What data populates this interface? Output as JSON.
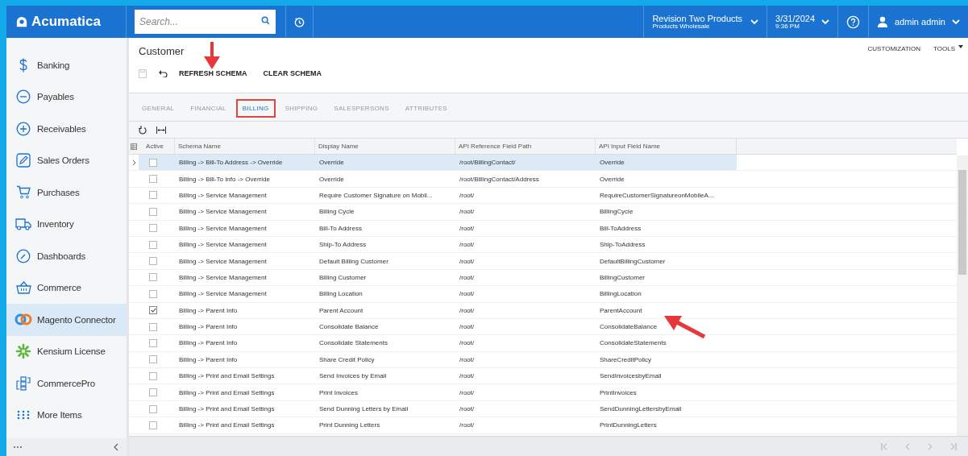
{
  "header": {
    "logo": "Acumatica",
    "search": {
      "placeholder": "Search..."
    },
    "company": {
      "name": "Revision Two Products",
      "branch": "Products Wholesale"
    },
    "datetime": {
      "date": "3/31/2024",
      "time": "9:36 PM"
    },
    "user": "admin admin"
  },
  "sidebar": {
    "items": [
      {
        "label": "Banking",
        "kind": "dollar",
        "selected": false
      },
      {
        "label": "Payables",
        "kind": "minus",
        "selected": false
      },
      {
        "label": "Receivables",
        "kind": "plus",
        "selected": false
      },
      {
        "label": "Sales Orders",
        "kind": "pencil",
        "selected": false
      },
      {
        "label": "Purchases",
        "kind": "cart",
        "selected": false
      },
      {
        "label": "Inventory",
        "kind": "truck",
        "selected": false
      },
      {
        "label": "Dashboards",
        "kind": "gauge",
        "selected": false
      },
      {
        "label": "Commerce",
        "kind": "basket",
        "selected": false
      },
      {
        "label": "Magento Connector",
        "kind": "rings",
        "selected": true
      },
      {
        "label": "Kensium License",
        "kind": "burst",
        "selected": false
      },
      {
        "label": "CommercePro",
        "kind": "blocks",
        "selected": false
      },
      {
        "label": "More Items",
        "kind": "dots",
        "selected": false
      }
    ]
  },
  "page": {
    "title": "Customer",
    "actions": [
      "REFRESH SCHEMA",
      "CLEAR SCHEMA"
    ],
    "links": [
      "CUSTOMIZATION",
      "TOOLS"
    ]
  },
  "tabs": [
    {
      "label": "GENERAL",
      "selected": false,
      "highlighted": false
    },
    {
      "label": "FINANCIAL",
      "selected": false,
      "highlighted": false
    },
    {
      "label": "BILLING",
      "selected": true,
      "highlighted": true
    },
    {
      "label": "SHIPPING",
      "selected": false,
      "highlighted": false
    },
    {
      "label": "SALESPERSONS",
      "selected": false,
      "highlighted": false
    },
    {
      "label": "ATTRIBUTES",
      "selected": false,
      "highlighted": false
    }
  ],
  "table": {
    "columns": [
      "Active",
      "Schema Name",
      "Display Name",
      "API Reference Field Path",
      "API Input Field Name"
    ],
    "rows": [
      {
        "selected": true,
        "active": false,
        "schema": "Billing -> Bill-To Address -> Override",
        "display": "Override",
        "path": "/root/BillingContact/",
        "input": "Override"
      },
      {
        "selected": false,
        "active": false,
        "schema": "Billing -> Bill-To Info -> Override",
        "display": "Override",
        "path": "/root/BillingContact/Address",
        "input": "Override"
      },
      {
        "selected": false,
        "active": false,
        "schema": "Billing -> Service Management",
        "display": "Require Customer Signature on Mobil...",
        "path": "/root/",
        "input": "RequireCustomerSignatureonMobileA..."
      },
      {
        "selected": false,
        "active": false,
        "schema": "Billing -> Service Management",
        "display": "Billing Cycle",
        "path": "/root/",
        "input": "BillingCycle"
      },
      {
        "selected": false,
        "active": false,
        "schema": "Billing -> Service Management",
        "display": "Bill-To Address",
        "path": "/root/",
        "input": "Bill-ToAddress"
      },
      {
        "selected": false,
        "active": false,
        "schema": "Billing -> Service Management",
        "display": "Ship-To Address",
        "path": "/root/",
        "input": "Ship-ToAddress"
      },
      {
        "selected": false,
        "active": false,
        "schema": "Billing -> Service Management",
        "display": "Default Billing Customer",
        "path": "/root/",
        "input": "DefaultBillingCustomer"
      },
      {
        "selected": false,
        "active": false,
        "schema": "Billing -> Service Management",
        "display": "Billing Customer",
        "path": "/root/",
        "input": "BillingCustomer"
      },
      {
        "selected": false,
        "active": false,
        "schema": "Billing -> Service Management",
        "display": "Billing Location",
        "path": "/root/",
        "input": "BillingLocation"
      },
      {
        "selected": false,
        "active": true,
        "schema": "Billing -> Parent Info",
        "display": "Parent Account",
        "path": "/root/",
        "input": "ParentAccount"
      },
      {
        "selected": false,
        "active": false,
        "schema": "Billing -> Parent Info",
        "display": "Consolidate Balance",
        "path": "/root/",
        "input": "ConsolidateBalance"
      },
      {
        "selected": false,
        "active": false,
        "schema": "Billing -> Parent Info",
        "display": "Consolidate Statements",
        "path": "/root/",
        "input": "ConsolidateStatements"
      },
      {
        "selected": false,
        "active": false,
        "schema": "Billing -> Parent Info",
        "display": "Share Credit Policy",
        "path": "/root/",
        "input": "ShareCreditPolicy"
      },
      {
        "selected": false,
        "active": false,
        "schema": "Billing -> Print and Email Settings",
        "display": "Send Invoices by Email",
        "path": "/root/",
        "input": "SendInvoicesbyEmail"
      },
      {
        "selected": false,
        "active": false,
        "schema": "Billing -> Print and Email Settings",
        "display": "Print Invoices",
        "path": "/root/",
        "input": "PrintInvoices"
      },
      {
        "selected": false,
        "active": false,
        "schema": "Billing -> Print and Email Settings",
        "display": "Send Dunning Letters by Email",
        "path": "/root/",
        "input": "SendDunningLettersbyEmail"
      },
      {
        "selected": false,
        "active": false,
        "schema": "Billing -> Print and Email Settings",
        "display": "Print Dunning Letters",
        "path": "/root/",
        "input": "PrintDunningLetters"
      }
    ]
  }
}
